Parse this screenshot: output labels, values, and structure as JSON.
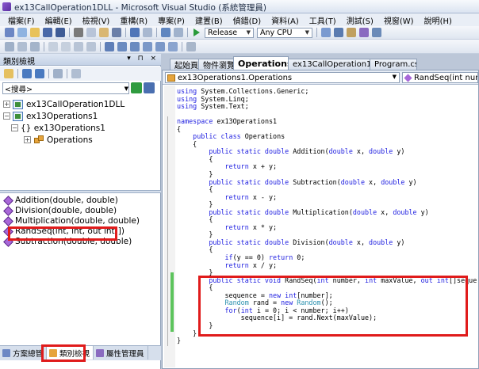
{
  "window": {
    "title": "ex13CallOperation1DLL - Microsoft Visual Studio (系統管理員)"
  },
  "menu": [
    "檔案(F)",
    "編輯(E)",
    "檢視(V)",
    "重構(R)",
    "專案(P)",
    "建置(B)",
    "偵錯(D)",
    "資料(A)",
    "工具(T)",
    "測試(S)",
    "視窗(W)",
    "說明(H)"
  ],
  "toolbar": {
    "config": "Release",
    "platform": "Any CPU"
  },
  "classview": {
    "title": "類別檢視",
    "pane_buttons": "▾ ⊓ ×",
    "search_placeholder": "<搜尋>",
    "tree": [
      {
        "label": "ex13CallOperation1DLL",
        "expander": "+",
        "kind": "project",
        "indent": 0
      },
      {
        "label": "ex13Operations1",
        "expander": "−",
        "kind": "project",
        "indent": 0
      },
      {
        "label": "{} ex13Operations1",
        "expander": "−",
        "kind": "namespace",
        "indent": 1
      },
      {
        "label": "Operations",
        "expander": "+",
        "kind": "class",
        "indent": 2
      }
    ],
    "members": [
      "Addition(double, double)",
      "Division(double, double)",
      "Multiplication(double, double)",
      "RandSeq(int, int, out int[])",
      "Subtraction(double, double)"
    ]
  },
  "bottom_tabs": [
    "方案總管",
    "類別檢視",
    "屬性管理員"
  ],
  "doc_tabs": [
    "起始頁",
    "物件瀏覽器",
    "Operations.cs",
    "ex13CallOperation1DLL",
    "Program.cs"
  ],
  "navbar": {
    "type": "ex13Operations1.Operations",
    "member": "RandSeq(int number"
  },
  "code_lines": [
    [
      [
        "kw",
        "using"
      ],
      [
        "",
        "System.Collections.Generic;"
      ]
    ],
    [
      [
        "kw",
        "using"
      ],
      [
        "",
        "System.Linq;"
      ]
    ],
    [
      [
        "kw",
        "using"
      ],
      [
        "",
        "System.Text;"
      ]
    ],
    [],
    [
      [
        "kw",
        "namespace"
      ],
      [
        "",
        "ex13Operations1"
      ]
    ],
    [
      [
        "",
        "{"
      ]
    ],
    [
      [
        "",
        "    "
      ],
      [
        "kw",
        "public class"
      ],
      [
        "",
        "Operations"
      ]
    ],
    [
      [
        "",
        "    {"
      ]
    ],
    [
      [
        "",
        "        "
      ],
      [
        "kw",
        "public static double"
      ],
      [
        "",
        "Addition("
      ],
      [
        "kw",
        "double"
      ],
      [
        "",
        "x, "
      ],
      [
        "kw",
        "double"
      ],
      [
        "",
        "y)"
      ]
    ],
    [
      [
        "",
        "        {"
      ]
    ],
    [
      [
        "",
        "            "
      ],
      [
        "kw",
        "return"
      ],
      [
        "",
        "x + y;"
      ]
    ],
    [
      [
        "",
        "        }"
      ]
    ],
    [
      [
        "",
        "        "
      ],
      [
        "kw",
        "public static double"
      ],
      [
        "",
        "Subtraction("
      ],
      [
        "kw",
        "double"
      ],
      [
        "",
        "x, "
      ],
      [
        "kw",
        "double"
      ],
      [
        "",
        "y)"
      ]
    ],
    [
      [
        "",
        "        {"
      ]
    ],
    [
      [
        "",
        "            "
      ],
      [
        "kw",
        "return"
      ],
      [
        "",
        "x - y;"
      ]
    ],
    [
      [
        "",
        "        }"
      ]
    ],
    [
      [
        "",
        "        "
      ],
      [
        "kw",
        "public static double"
      ],
      [
        "",
        "Multiplication("
      ],
      [
        "kw",
        "double"
      ],
      [
        "",
        "x, "
      ],
      [
        "kw",
        "double"
      ],
      [
        "",
        "y)"
      ]
    ],
    [
      [
        "",
        "        {"
      ]
    ],
    [
      [
        "",
        "            "
      ],
      [
        "kw",
        "return"
      ],
      [
        "",
        "x * y;"
      ]
    ],
    [
      [
        "",
        "        }"
      ]
    ],
    [
      [
        "",
        "        "
      ],
      [
        "kw",
        "public static double"
      ],
      [
        "",
        "Division("
      ],
      [
        "kw",
        "double"
      ],
      [
        "",
        "x, "
      ],
      [
        "kw",
        "double"
      ],
      [
        "",
        "y)"
      ]
    ],
    [
      [
        "",
        "        {"
      ]
    ],
    [
      [
        "",
        "            "
      ],
      [
        "kw",
        "if"
      ],
      [
        "",
        "(y == 0) "
      ],
      [
        "kw",
        "return"
      ],
      [
        "",
        "0;"
      ]
    ],
    [
      [
        "",
        "            "
      ],
      [
        "kw",
        "return"
      ],
      [
        "",
        "x / y;"
      ]
    ],
    [
      [
        "",
        "        }"
      ]
    ],
    [
      [
        "",
        "        "
      ],
      [
        "kw",
        "public static void"
      ],
      [
        "",
        "RandSeq("
      ],
      [
        "kw",
        "int"
      ],
      [
        "",
        "number, "
      ],
      [
        "kw",
        "int"
      ],
      [
        "",
        "maxValue, "
      ],
      [
        "kw",
        "out int"
      ],
      [
        "",
        "[]sequence)"
      ]
    ],
    [
      [
        "",
        "        {"
      ]
    ],
    [
      [
        "",
        "            sequence = "
      ],
      [
        "kw",
        "new int"
      ],
      [
        "",
        "[number];"
      ]
    ],
    [
      [
        "",
        "            "
      ],
      [
        "ty",
        "Random"
      ],
      [
        "",
        "rand = "
      ],
      [
        "kw",
        "new"
      ],
      [
        "ty",
        "Random"
      ],
      [
        "",
        "();"
      ]
    ],
    [
      [
        "",
        "            "
      ],
      [
        "kw",
        "for"
      ],
      [
        "",
        "("
      ],
      [
        "kw",
        "int"
      ],
      [
        "",
        "i = 0; i < number; i++)"
      ]
    ],
    [
      [
        "",
        "                sequence[i] = rand.Next(maxValue);"
      ]
    ],
    [
      [
        "",
        "        }"
      ]
    ],
    [
      [
        "",
        "    }"
      ]
    ],
    [
      [
        "",
        "}"
      ]
    ]
  ]
}
